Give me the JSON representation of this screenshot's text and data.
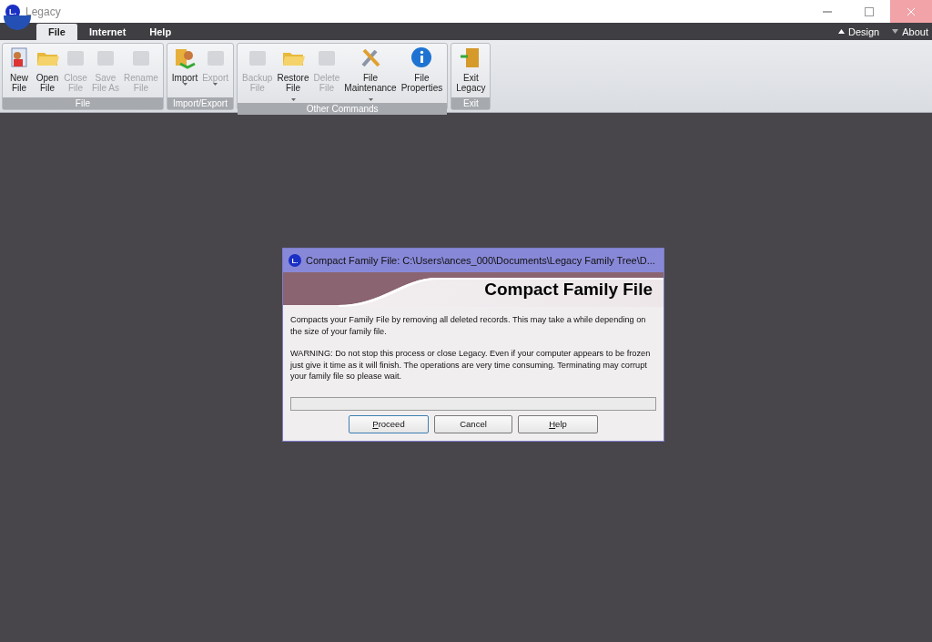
{
  "window": {
    "logo": "L.",
    "title": "Legacy"
  },
  "menu": {
    "tabs": [
      {
        "label": "File",
        "selected": true
      },
      {
        "label": "Internet",
        "selected": false
      },
      {
        "label": "Help",
        "selected": false
      }
    ],
    "right": [
      {
        "label": "Design",
        "expanded": true
      },
      {
        "label": "About",
        "expanded": false
      }
    ]
  },
  "ribbon": [
    {
      "name": "File",
      "buttons": [
        {
          "lines": [
            "New",
            "File"
          ],
          "disabled": false,
          "dropdown": false
        },
        {
          "lines": [
            "Open",
            "File"
          ],
          "disabled": false,
          "dropdown": false
        },
        {
          "lines": [
            "Close",
            "File"
          ],
          "disabled": true,
          "dropdown": false
        },
        {
          "lines": [
            "Save",
            "File As"
          ],
          "disabled": true,
          "dropdown": false
        },
        {
          "lines": [
            "Rename",
            "File"
          ],
          "disabled": true,
          "dropdown": false
        }
      ]
    },
    {
      "name": "Import/Export",
      "buttons": [
        {
          "lines": [
            "Import"
          ],
          "disabled": false,
          "dropdown": true
        },
        {
          "lines": [
            "Export"
          ],
          "disabled": true,
          "dropdown": true
        }
      ]
    },
    {
      "name": "Other Commands",
      "buttons": [
        {
          "lines": [
            "Backup",
            "File"
          ],
          "disabled": true,
          "dropdown": false
        },
        {
          "lines": [
            "Restore",
            "File"
          ],
          "disabled": false,
          "dropdown": true
        },
        {
          "lines": [
            "Delete",
            "File"
          ],
          "disabled": true,
          "dropdown": false
        },
        {
          "lines": [
            "File",
            "Maintenance"
          ],
          "disabled": false,
          "dropdown": true
        },
        {
          "lines": [
            "File",
            "Properties"
          ],
          "disabled": false,
          "dropdown": false
        }
      ]
    },
    {
      "name": "Exit",
      "buttons": [
        {
          "lines": [
            "Exit",
            "Legacy"
          ],
          "disabled": false,
          "dropdown": false
        }
      ]
    }
  ],
  "dialog": {
    "logo": "L.",
    "title": "Compact Family File: C:\\Users\\ances_000\\Documents\\Legacy Family Tree\\D...",
    "heading": "Compact Family File",
    "paragraphs": [
      "Compacts your Family File by removing all deleted records.  This may take a while depending on the size of your family file.",
      "WARNING:  Do not stop this process or close Legacy.  Even if your computer appears to be frozen just give it time as it will finish.   The operations are very time consuming.   Terminating may corrupt your family file so please wait."
    ],
    "progress": {
      "level": 0
    },
    "buttons": [
      {
        "mnemonic": "P",
        "rest": "roceed",
        "default": true
      },
      {
        "label": "Cancel",
        "default": false
      },
      {
        "mnemonic": "H",
        "rest": "elp",
        "default": false
      }
    ]
  }
}
